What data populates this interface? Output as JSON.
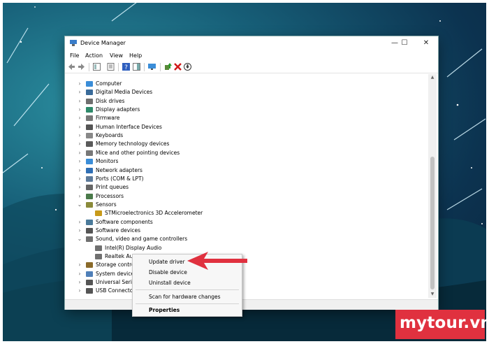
{
  "window": {
    "title": "Device Manager"
  },
  "window_controls": {
    "minimize": "—",
    "maximize": "☐",
    "close": "✕"
  },
  "menu": [
    "File",
    "Action",
    "View",
    "Help"
  ],
  "tree": [
    {
      "label": "Computer",
      "chevron": "›",
      "icon": "computer-icon"
    },
    {
      "label": "Digital Media Devices",
      "chevron": "›",
      "icon": "media-device-icon"
    },
    {
      "label": "Disk drives",
      "chevron": "›",
      "icon": "disk-drive-icon"
    },
    {
      "label": "Display adapters",
      "chevron": "›",
      "icon": "display-adapter-icon"
    },
    {
      "label": "Firmware",
      "chevron": "›",
      "icon": "firmware-icon"
    },
    {
      "label": "Human Interface Devices",
      "chevron": "›",
      "icon": "hid-icon"
    },
    {
      "label": "Keyboards",
      "chevron": "›",
      "icon": "keyboard-icon"
    },
    {
      "label": "Memory technology devices",
      "chevron": "›",
      "icon": "memory-icon"
    },
    {
      "label": "Mice and other pointing devices",
      "chevron": "›",
      "icon": "mouse-icon"
    },
    {
      "label": "Monitors",
      "chevron": "›",
      "icon": "monitor-icon"
    },
    {
      "label": "Network adapters",
      "chevron": "›",
      "icon": "network-icon"
    },
    {
      "label": "Ports (COM & LPT)",
      "chevron": "›",
      "icon": "port-icon"
    },
    {
      "label": "Print queues",
      "chevron": "›",
      "icon": "printer-icon"
    },
    {
      "label": "Processors",
      "chevron": "›",
      "icon": "processor-icon"
    },
    {
      "label": "Sensors",
      "chevron": "⌄",
      "icon": "sensor-icon"
    },
    {
      "label": "STMicroelectronics 3D Accelerometer",
      "chevron": "",
      "icon": "accelerometer-icon"
    },
    {
      "label": "Software components",
      "chevron": "›",
      "icon": "software-component-icon"
    },
    {
      "label": "Software devices",
      "chevron": "›",
      "icon": "software-device-icon"
    },
    {
      "label": "Sound, video and game controllers",
      "chevron": "⌄",
      "icon": "speaker-icon"
    },
    {
      "label": "Intel(R) Display Audio",
      "chevron": "",
      "icon": "speaker-icon"
    },
    {
      "label": "Realtek Audio",
      "chevron": "",
      "icon": "speaker-icon"
    },
    {
      "label": "Storage controllers",
      "chevron": "›",
      "icon": "storage-icon"
    },
    {
      "label": "System devices",
      "chevron": "›",
      "icon": "system-device-icon"
    },
    {
      "label": "Universal Serial Bus controllers",
      "chevron": "›",
      "icon": "usb-icon"
    },
    {
      "label": "USB Connector Managers",
      "chevron": "›",
      "icon": "usb-connector-icon"
    }
  ],
  "context_menu": {
    "items": [
      "Update driver",
      "Disable device",
      "Uninstall device",
      "Scan for hardware changes",
      "Properties"
    ]
  },
  "watermark": "mytour.vn",
  "colors": {
    "accent_red": "#e0313f",
    "brand_bg": "#e0313f"
  }
}
